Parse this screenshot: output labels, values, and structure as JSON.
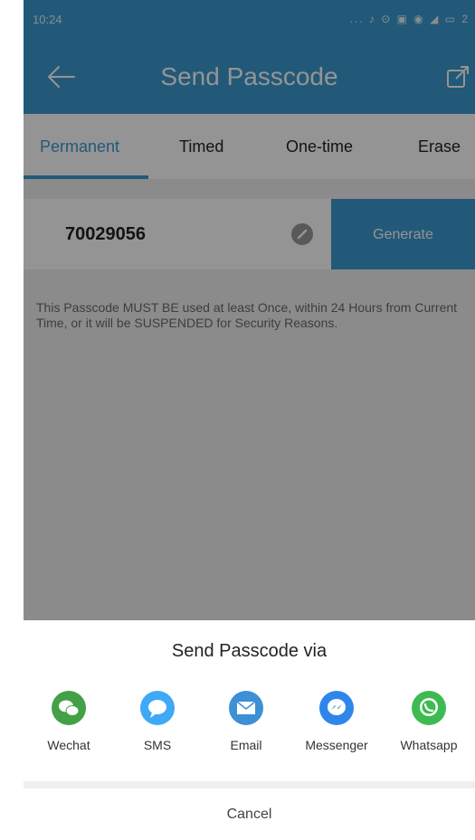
{
  "status_bar": {
    "time": "10:24",
    "icons_text": "... ♪ ⊙ ▣ ◉ ◢ ▭ 2"
  },
  "app_bar": {
    "title": "Send Passcode",
    "back_icon": "back-arrow-icon",
    "share_icon": "share-icon"
  },
  "tabs": [
    {
      "label": "Permanent",
      "active": true
    },
    {
      "label": "Timed",
      "active": false
    },
    {
      "label": "One-time",
      "active": false
    },
    {
      "label": "Erase",
      "active": false
    }
  ],
  "passcode": {
    "value": "70029056",
    "generate_label": "Generate"
  },
  "notice": "This Passcode MUST BE used at least Once, within 24 Hours from Current Time, or it will be SUSPENDED for Security Reasons.",
  "share_sheet": {
    "title": "Send Passcode via",
    "options": [
      {
        "label": "Wechat",
        "icon": "wechat-icon",
        "color": "#43a047"
      },
      {
        "label": "SMS",
        "icon": "sms-icon",
        "color": "#3fa9f5"
      },
      {
        "label": "Email",
        "icon": "email-icon",
        "color": "#3d8fd6"
      },
      {
        "label": "Messenger",
        "icon": "messenger-icon",
        "color": "#2f86ea"
      },
      {
        "label": "Whatsapp",
        "icon": "whatsapp-icon",
        "color": "#3dbb52"
      }
    ],
    "cancel_label": "Cancel"
  },
  "colors": {
    "accent": "#3b9ad0",
    "overlay": "rgba(0,0,0,0.42)"
  }
}
